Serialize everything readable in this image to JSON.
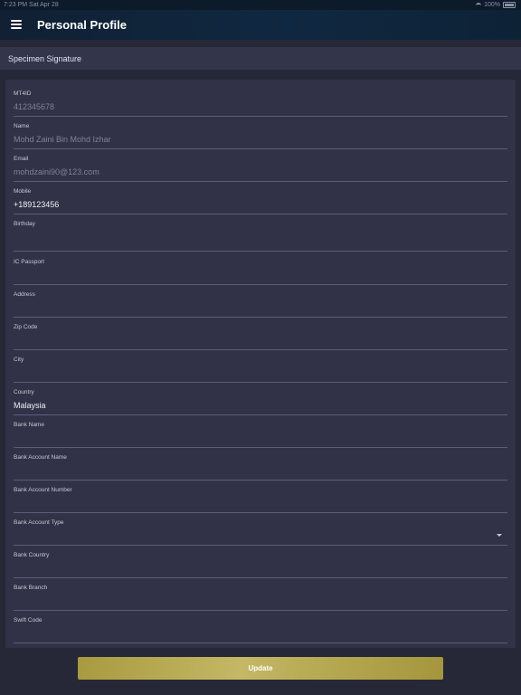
{
  "status": {
    "time": "7:23 PM",
    "date": "Sat Apr 28",
    "battery": "100%"
  },
  "header": {
    "title": "Personal Profile"
  },
  "section": {
    "title": "Specimen Signature"
  },
  "fields": [
    {
      "label": "MT4ID",
      "value": "412345678"
    },
    {
      "label": "Name",
      "value": "Mohd Zaini Bin Mohd Izhar"
    },
    {
      "label": "Email",
      "value": "mohdzaini90@123.com"
    },
    {
      "label": "Mobile",
      "value": "+189123456"
    },
    {
      "label": "Birthday",
      "value": ""
    },
    {
      "label": "IC Passport",
      "value": ""
    },
    {
      "label": "Address",
      "value": ""
    },
    {
      "label": "Zip Code",
      "value": ""
    },
    {
      "label": "City",
      "value": ""
    },
    {
      "label": "Country",
      "value": "Malaysia"
    },
    {
      "label": "Bank Name",
      "value": ""
    },
    {
      "label": "Bank Account Name",
      "value": ""
    },
    {
      "label": "Bank Account Number",
      "value": ""
    },
    {
      "label": "Bank Account Type",
      "value": ""
    },
    {
      "label": "Bank Country",
      "value": ""
    },
    {
      "label": "Bank Branch",
      "value": ""
    },
    {
      "label": "Swift Code",
      "value": ""
    }
  ],
  "actions": {
    "update_label": "Update"
  },
  "icons": {
    "menu": "menu-icon",
    "dropdown": "chevron-down-icon"
  },
  "colors": {
    "accent": "#b8ab55",
    "background": "#262838",
    "card": "#313247"
  }
}
